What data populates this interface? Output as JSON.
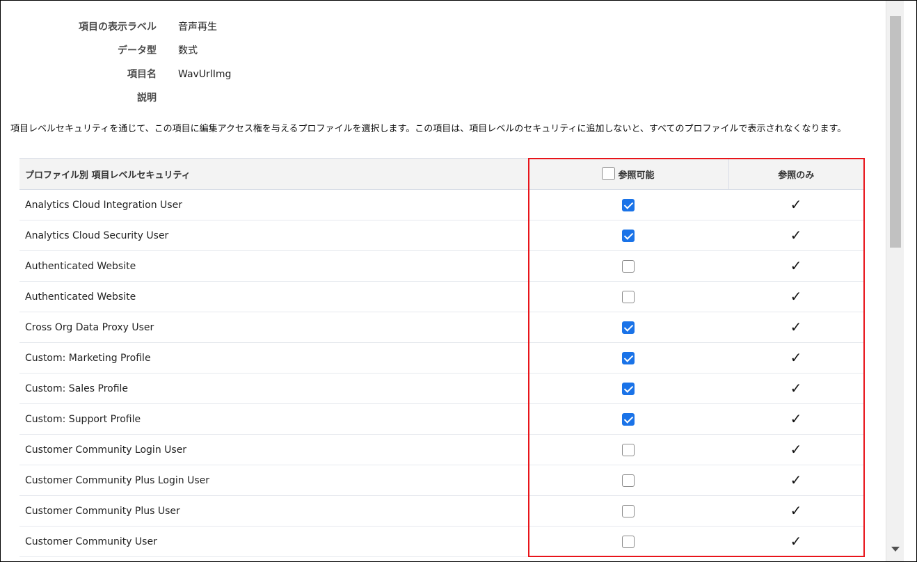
{
  "field_info": {
    "rows": [
      {
        "label": "項目の表示ラベル",
        "value": "音声再生"
      },
      {
        "label": "データ型",
        "value": "数式"
      },
      {
        "label": "項目名",
        "value": "WavUrlImg"
      },
      {
        "label": "説明",
        "value": ""
      }
    ]
  },
  "description": "項目レベルセキュリティを通じて、この項目に編集アクセス権を与えるプロファイルを選択します。この項目は、項目レベルのセキュリティに追加しないと、すべてのプロファイルで表示されなくなります。",
  "table": {
    "headers": {
      "profile": "プロファイル別 項目レベルセキュリティ",
      "visible": "参照可能",
      "readonly": "参照のみ"
    },
    "rows": [
      {
        "name": "Analytics Cloud Integration User",
        "visible": true,
        "readonly": true
      },
      {
        "name": "Analytics Cloud Security User",
        "visible": true,
        "readonly": true
      },
      {
        "name": "Authenticated Website",
        "visible": false,
        "readonly": true
      },
      {
        "name": "Authenticated Website",
        "visible": false,
        "readonly": true
      },
      {
        "name": "Cross Org Data Proxy User",
        "visible": true,
        "readonly": true
      },
      {
        "name": "Custom: Marketing Profile",
        "visible": true,
        "readonly": true
      },
      {
        "name": "Custom: Sales Profile",
        "visible": true,
        "readonly": true
      },
      {
        "name": "Custom: Support Profile",
        "visible": true,
        "readonly": true
      },
      {
        "name": "Customer Community Login User",
        "visible": false,
        "readonly": true
      },
      {
        "name": "Customer Community Plus Login User",
        "visible": false,
        "readonly": true
      },
      {
        "name": "Customer Community Plus User",
        "visible": false,
        "readonly": true
      },
      {
        "name": "Customer Community User",
        "visible": false,
        "readonly": true
      }
    ]
  },
  "icons": {
    "check_mark": "✓",
    "scroll_down": "scroll-down-arrow-icon"
  },
  "colors": {
    "checkbox_checked": "#1a73e8",
    "highlight_border": "#e8141a",
    "header_bg": "#f3f3f3"
  }
}
